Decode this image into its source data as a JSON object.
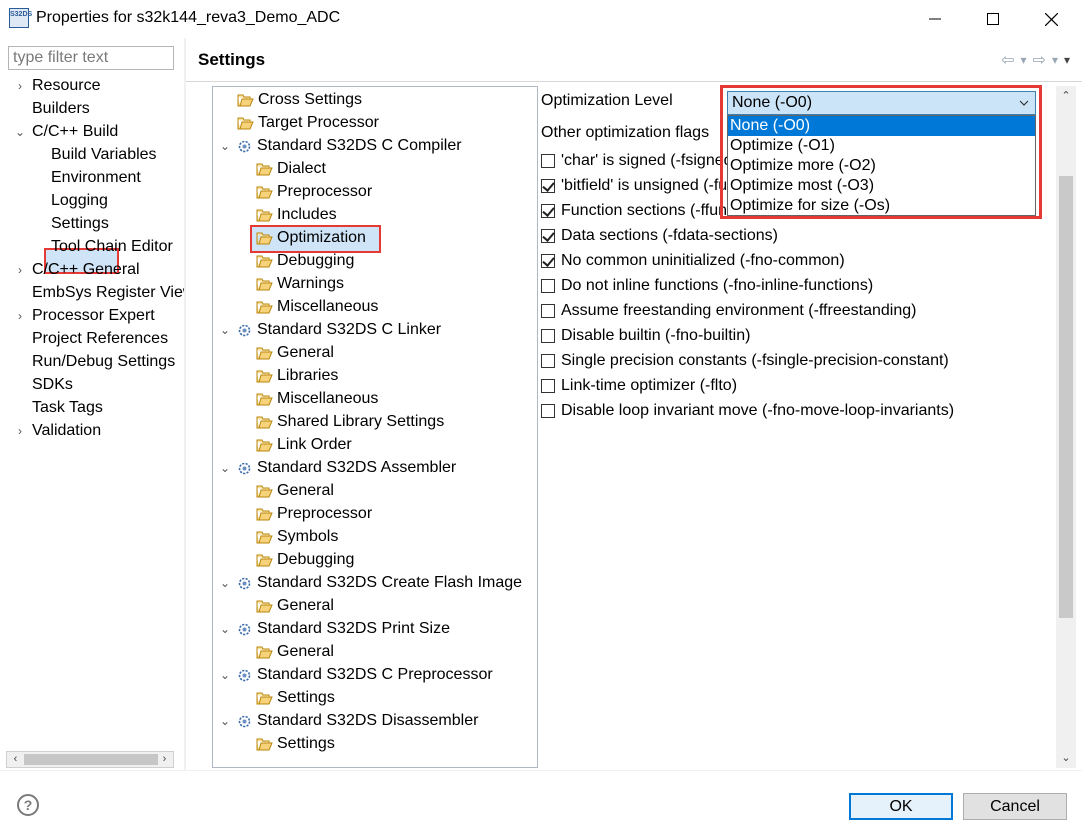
{
  "window": {
    "title": "Properties for s32k144_reva3_Demo_ADC",
    "icon": "s32ds-app-icon",
    "icon_text": "S32DS",
    "controls": [
      "minimize-icon",
      "maximize-icon",
      "close-icon"
    ]
  },
  "filter": {
    "placeholder": "type filter text",
    "value": ""
  },
  "nav": {
    "items": [
      {
        "label": "Resource",
        "arrow": "›"
      },
      {
        "label": "Builders",
        "arrow": ""
      },
      {
        "label": "C/C++ Build",
        "arrow": "⌄"
      },
      {
        "label": "Build Variables",
        "arrow": ""
      },
      {
        "label": "Environment",
        "arrow": ""
      },
      {
        "label": "Logging",
        "arrow": ""
      },
      {
        "label": "Settings",
        "arrow": ""
      },
      {
        "label": "Tool Chain Editor",
        "arrow": ""
      },
      {
        "label": "C/C++ General",
        "arrow": "›"
      },
      {
        "label": "EmbSys Register View",
        "arrow": ""
      },
      {
        "label": "Processor Expert",
        "arrow": "›"
      },
      {
        "label": "Project References",
        "arrow": ""
      },
      {
        "label": "Run/Debug Settings",
        "arrow": ""
      },
      {
        "label": "SDKs",
        "arrow": ""
      },
      {
        "label": "Task Tags",
        "arrow": ""
      },
      {
        "label": "Validation",
        "arrow": "›"
      }
    ],
    "selected": "Settings",
    "scroll_left": "‹",
    "scroll_right": "›"
  },
  "page": {
    "title": "Settings",
    "history": {
      "back": "⇦",
      "back_menu": "▾",
      "forward": "⇨",
      "forward_menu": "▾",
      "menu": "▾"
    }
  },
  "tool_tree": {
    "items": [
      {
        "label": "Cross Settings",
        "type": "folder"
      },
      {
        "label": "Target Processor",
        "type": "folder"
      },
      {
        "label": "Standard S32DS C Compiler",
        "type": "tool"
      },
      {
        "label": "Dialect",
        "type": "folder"
      },
      {
        "label": "Preprocessor",
        "type": "folder"
      },
      {
        "label": "Includes",
        "type": "folder"
      },
      {
        "label": "Optimization",
        "type": "folder"
      },
      {
        "label": "Debugging",
        "type": "folder"
      },
      {
        "label": "Warnings",
        "type": "folder"
      },
      {
        "label": "Miscellaneous",
        "type": "folder"
      },
      {
        "label": "Standard S32DS C Linker",
        "type": "tool"
      },
      {
        "label": "General",
        "type": "folder"
      },
      {
        "label": "Libraries",
        "type": "folder"
      },
      {
        "label": "Miscellaneous",
        "type": "folder"
      },
      {
        "label": "Shared Library Settings",
        "type": "folder"
      },
      {
        "label": "Link Order",
        "type": "folder"
      },
      {
        "label": "Standard S32DS Assembler",
        "type": "tool"
      },
      {
        "label": "General",
        "type": "folder"
      },
      {
        "label": "Preprocessor",
        "type": "folder"
      },
      {
        "label": "Symbols",
        "type": "folder"
      },
      {
        "label": "Debugging",
        "type": "folder"
      },
      {
        "label": "Standard S32DS Create Flash Image",
        "type": "tool"
      },
      {
        "label": "General",
        "type": "folder"
      },
      {
        "label": "Standard S32DS Print Size",
        "type": "tool"
      },
      {
        "label": "General",
        "type": "folder"
      },
      {
        "label": "Standard S32DS C Preprocessor",
        "type": "tool"
      },
      {
        "label": "Settings",
        "type": "folder"
      },
      {
        "label": "Standard S32DS Disassembler",
        "type": "tool"
      },
      {
        "label": "Settings",
        "type": "folder"
      }
    ],
    "selected": "Optimization",
    "expand_glyph": "⌄"
  },
  "optimization": {
    "level_label": "Optimization Level",
    "level_value": "None (-O0)",
    "level_options": [
      "None (-O0)",
      "Optimize (-O1)",
      "Optimize more (-O2)",
      "Optimize most (-O3)",
      "Optimize for size (-Os)"
    ],
    "other_flags_label": "Other optimization flags",
    "flags": [
      {
        "label": "'char' is signed (-fsigned-char)",
        "checked": false
      },
      {
        "label": "'bitfield' is unsigned (-funsigned-bitfields)",
        "checked": true
      },
      {
        "label": "Function sections (-ffunction-sections)",
        "checked": true
      },
      {
        "label": "Data sections (-fdata-sections)",
        "checked": true
      },
      {
        "label": "No common uninitialized (-fno-common)",
        "checked": true
      },
      {
        "label": "Do not inline functions (-fno-inline-functions)",
        "checked": false
      },
      {
        "label": "Assume freestanding environment (-ffreestanding)",
        "checked": false
      },
      {
        "label": "Disable builtin (-fno-builtin)",
        "checked": false
      },
      {
        "label": "Single precision constants (-fsingle-precision-constant)",
        "checked": false
      },
      {
        "label": "Link-time optimizer (-flto)",
        "checked": false
      },
      {
        "label": "Disable loop invariant move (-fno-move-loop-invariants)",
        "checked": false
      }
    ],
    "scroll_up": "⌃",
    "scroll_down": "⌄"
  },
  "footer": {
    "help": "?",
    "ok_label": "OK",
    "cancel_label": "Cancel"
  },
  "colors": {
    "highlight_border": "#e53935",
    "selection_bg": "#cfe5f7",
    "dropdown_active": "#0078d7"
  }
}
